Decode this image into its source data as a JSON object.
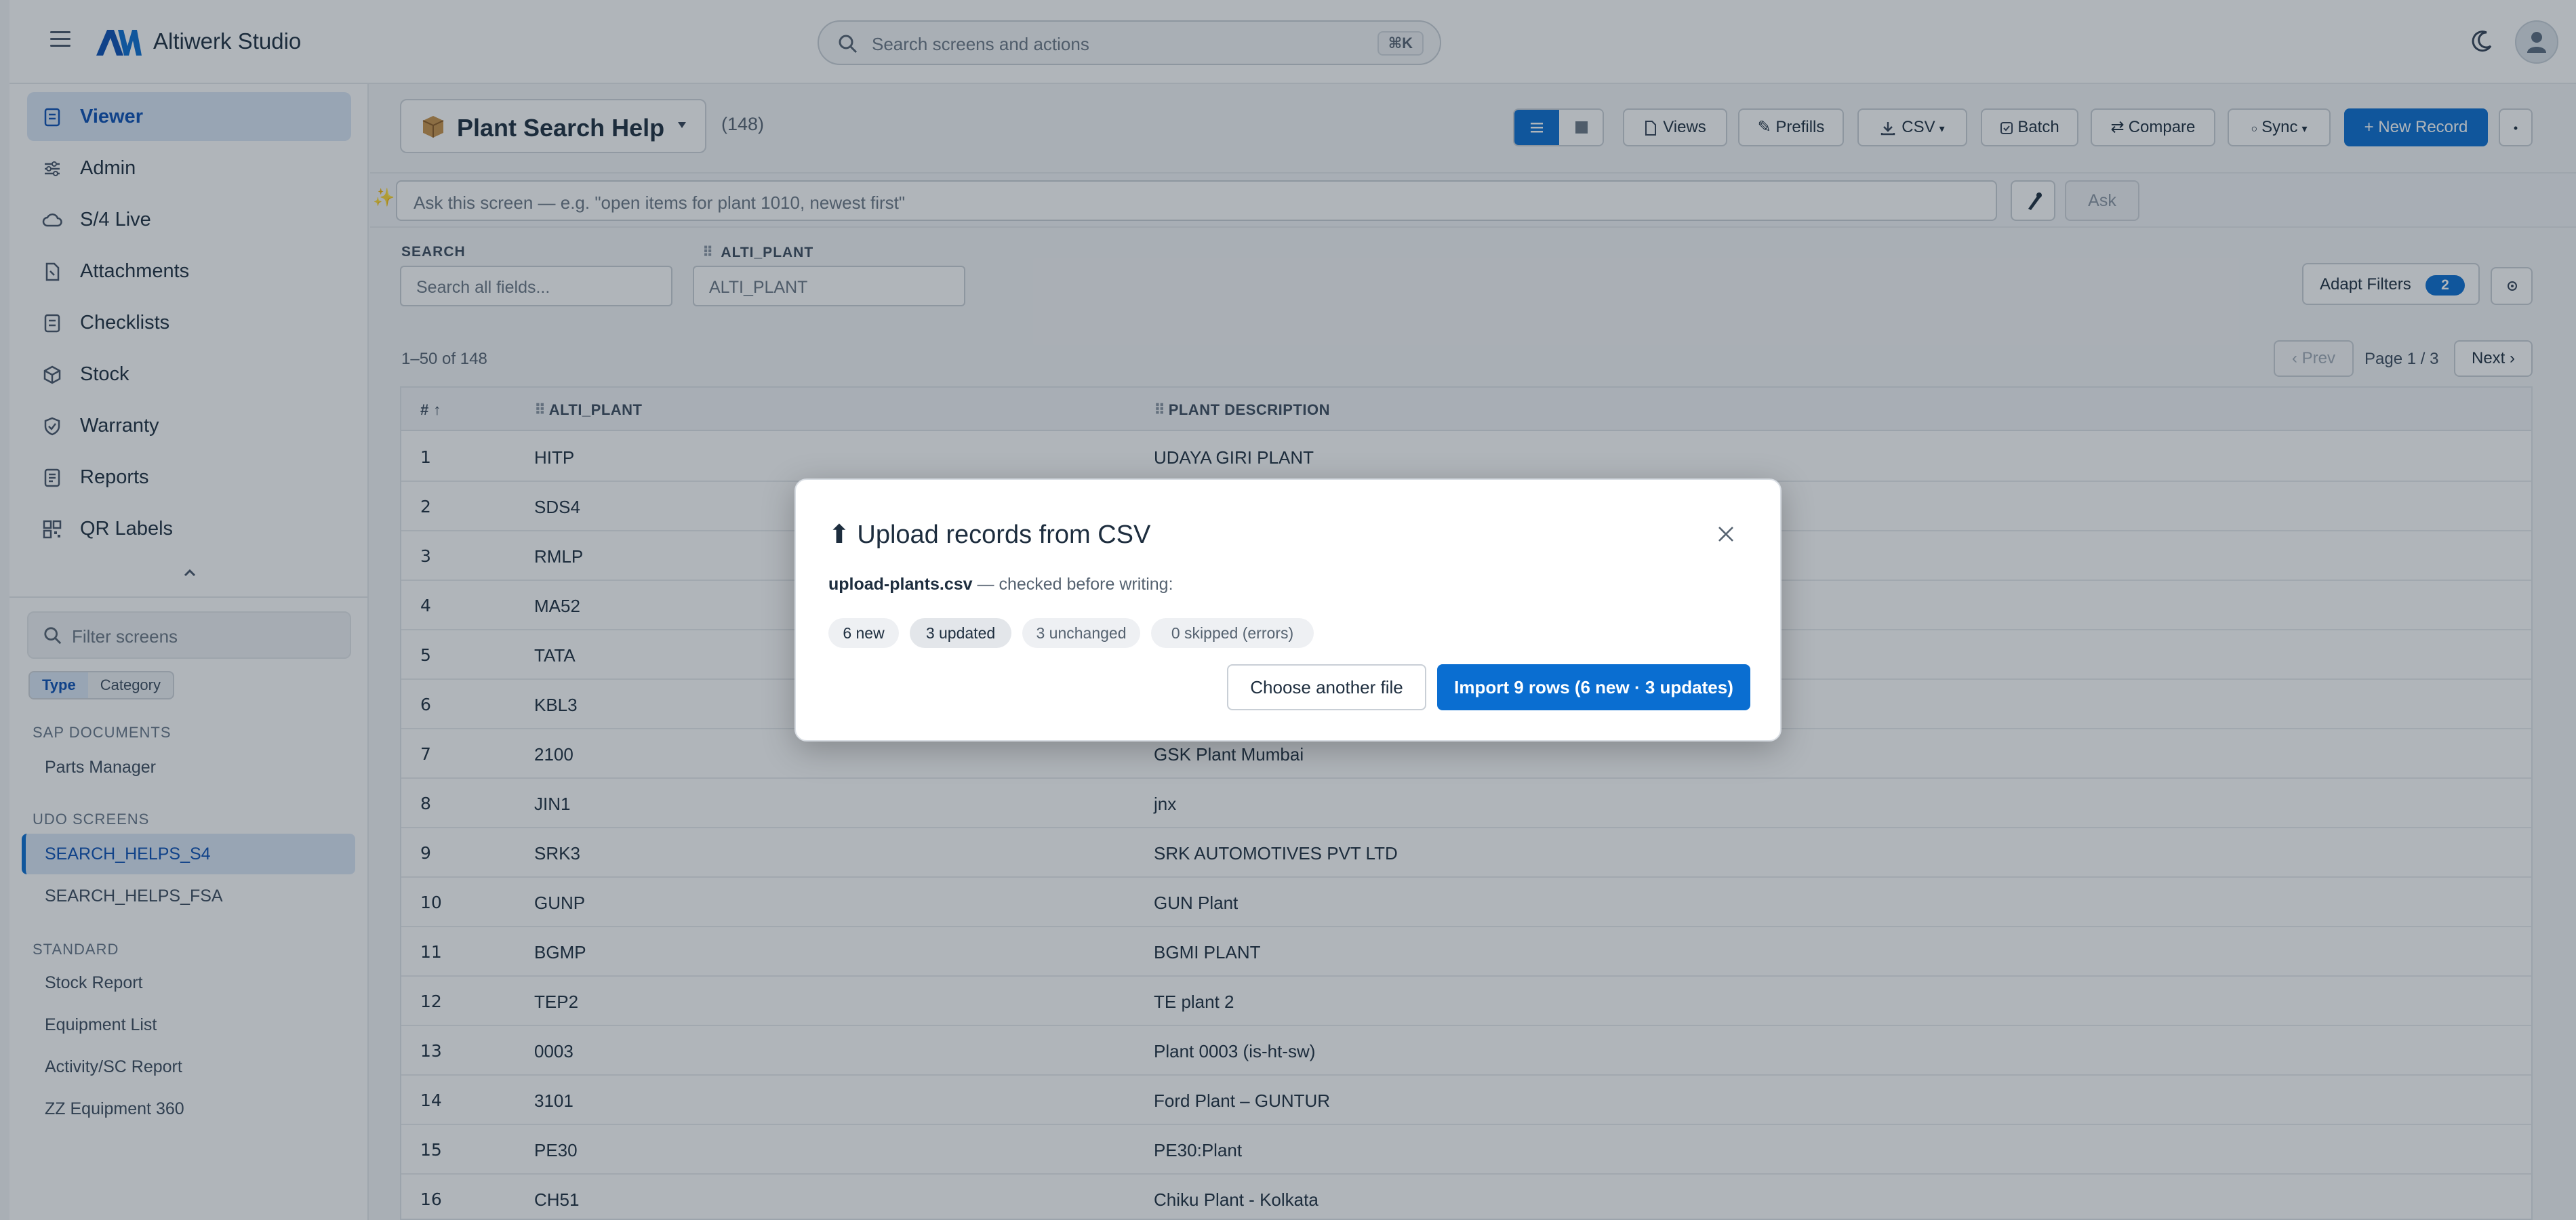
{
  "app": {
    "brand": "Altiwerk Studio",
    "search_placeholder": "Search screens and actions",
    "search_shortcut": "⌘K",
    "accent_color": "#0a6ed1"
  },
  "sidebar": {
    "nav": [
      {
        "label": "Viewer",
        "icon": "document-icon",
        "active": true
      },
      {
        "label": "Admin",
        "icon": "sliders-icon",
        "active": false
      },
      {
        "label": "S/4 Live",
        "icon": "cloud-icon",
        "active": false
      },
      {
        "label": "Attachments",
        "icon": "attachment-icon",
        "active": false
      },
      {
        "label": "Checklists",
        "icon": "checklist-icon",
        "active": false
      },
      {
        "label": "Stock",
        "icon": "box-icon",
        "active": false
      },
      {
        "label": "Warranty",
        "icon": "shield-icon",
        "active": false
      },
      {
        "label": "Reports",
        "icon": "report-icon",
        "active": false
      },
      {
        "label": "QR Labels",
        "icon": "qr-icon",
        "active": false
      }
    ],
    "filter_placeholder": "Filter screens",
    "toggle": {
      "type": "Type",
      "category": "Category"
    },
    "sections": [
      {
        "title": "SAP DOCUMENTS",
        "items": [
          "Parts Manager"
        ]
      },
      {
        "title": "UDO SCREENS",
        "items": [
          "SEARCH_HELPS_S4",
          "SEARCH_HELPS_FSA"
        ]
      },
      {
        "title": "STANDARD",
        "items": [
          "Stock Report",
          "Equipment List",
          "Activity/SC Report",
          "ZZ Equipment 360"
        ]
      }
    ],
    "current_item": "SEARCH_HELPS_S4"
  },
  "header": {
    "title": "Plant Search Help",
    "record_count": "(148)",
    "buttons": {
      "views": "Views",
      "prefills": "✎ Prefills",
      "csv": "CSV",
      "batch": "Batch",
      "compare": "Compare",
      "sync": "Sync",
      "new_record": "+ New Record"
    }
  },
  "ask": {
    "placeholder": "Ask this screen — e.g. \"open items for plant 1010, newest first\"",
    "button": "Ask"
  },
  "filters": {
    "search_label": "SEARCH",
    "search_placeholder": "Search all fields...",
    "plant_label": "ALTI_PLANT",
    "plant_placeholder": "ALTI_PLANT",
    "adapt_label": "Adapt Filters",
    "adapt_count": "2"
  },
  "paging": {
    "range": "1–50 of 148",
    "prev": "‹ Prev",
    "page_info": "Page 1 / 3",
    "next": "Next ›"
  },
  "table": {
    "columns": [
      "# ↑",
      "ALTI_PLANT",
      "PLANT DESCRIPTION"
    ],
    "rows": [
      {
        "n": "1",
        "plant": "HITP",
        "desc": "UDAYA GIRI PLANT"
      },
      {
        "n": "2",
        "plant": "SDS4",
        "desc": ""
      },
      {
        "n": "3",
        "plant": "RMLP",
        "desc": ""
      },
      {
        "n": "4",
        "plant": "MA52",
        "desc": ""
      },
      {
        "n": "5",
        "plant": "TATA",
        "desc": ""
      },
      {
        "n": "6",
        "plant": "KBL3",
        "desc": ""
      },
      {
        "n": "7",
        "plant": "2100",
        "desc": "GSK Plant Mumbai"
      },
      {
        "n": "8",
        "plant": "JIN1",
        "desc": "jnx"
      },
      {
        "n": "9",
        "plant": "SRK3",
        "desc": "SRK AUTOMOTIVES PVT LTD"
      },
      {
        "n": "10",
        "plant": "GUNP",
        "desc": "GUN Plant"
      },
      {
        "n": "11",
        "plant": "BGMP",
        "desc": "BGMI PLANT"
      },
      {
        "n": "12",
        "plant": "TEP2",
        "desc": "TE plant 2"
      },
      {
        "n": "13",
        "plant": "0003",
        "desc": "Plant 0003 (is-ht-sw)"
      },
      {
        "n": "14",
        "plant": "3101",
        "desc": "Ford Plant – GUNTUR"
      },
      {
        "n": "15",
        "plant": "PE30",
        "desc": "PE30:Plant"
      },
      {
        "n": "16",
        "plant": "CH51",
        "desc": "Chiku Plant - Kolkata"
      }
    ]
  },
  "modal": {
    "title": "⬆ Upload records from CSV",
    "file_name": "upload-plants.csv",
    "file_suffix": " — checked before writing:",
    "pills": [
      "6 new",
      "3 updated",
      "3 unchanged",
      "0 skipped (errors)"
    ],
    "secondary_button": "Choose another file",
    "primary_button": "Import 9 rows (6 new · 3 updates)"
  }
}
